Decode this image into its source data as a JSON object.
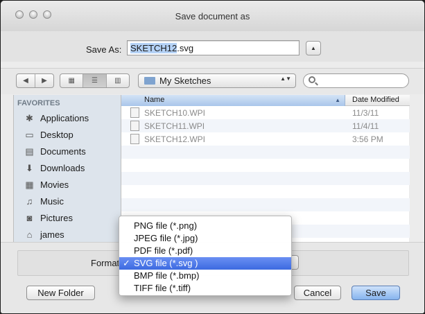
{
  "window": {
    "title": "Save document as"
  },
  "save": {
    "label": "Save As:",
    "filename_selected": "SKETCH12",
    "filename_ext": ".svg",
    "expand_glyph": "▲"
  },
  "toolbar": {
    "back_glyph": "◀",
    "forward_glyph": "▶",
    "view_icon_glyph": "▦",
    "view_list_glyph": "☰",
    "view_column_glyph": "▥",
    "folder": "My Sketches",
    "popup_arrows": "▲▼"
  },
  "sidebar": {
    "heading": "FAVORITES",
    "items": [
      {
        "label": "Applications",
        "icon": "applications-icon",
        "glyph": "✱"
      },
      {
        "label": "Desktop",
        "icon": "desktop-icon",
        "glyph": "▭"
      },
      {
        "label": "Documents",
        "icon": "documents-icon",
        "glyph": "▤"
      },
      {
        "label": "Downloads",
        "icon": "downloads-icon",
        "glyph": "⬇"
      },
      {
        "label": "Movies",
        "icon": "movies-icon",
        "glyph": "▦"
      },
      {
        "label": "Music",
        "icon": "music-icon",
        "glyph": "♫"
      },
      {
        "label": "Pictures",
        "icon": "pictures-icon",
        "glyph": "◙"
      },
      {
        "label": "james",
        "icon": "home-icon",
        "glyph": "⌂"
      }
    ]
  },
  "filelist": {
    "columns": {
      "name": "Name",
      "date": "Date Modified",
      "sort_glyph": "▲"
    },
    "files": [
      {
        "name": "SKETCH10.WPI",
        "date": "11/3/11"
      },
      {
        "name": "SKETCH11.WPI",
        "date": "11/4/11"
      },
      {
        "name": "SKETCH12.WPI",
        "date": "3:56 PM"
      }
    ]
  },
  "format": {
    "label": "Format",
    "check_glyph": "✓",
    "options": [
      {
        "label": "PNG file (*.png)",
        "selected": false
      },
      {
        "label": "JPEG file (*.jpg)",
        "selected": false
      },
      {
        "label": "PDF file (*.pdf)",
        "selected": false
      },
      {
        "label": "SVG file (*.svg )",
        "selected": true
      },
      {
        "label": "BMP file (*.bmp)",
        "selected": false
      },
      {
        "label": "TIFF file (*.tiff)",
        "selected": false
      }
    ]
  },
  "buttons": {
    "new_folder": "New Folder",
    "cancel": "Cancel",
    "save": "Save"
  }
}
